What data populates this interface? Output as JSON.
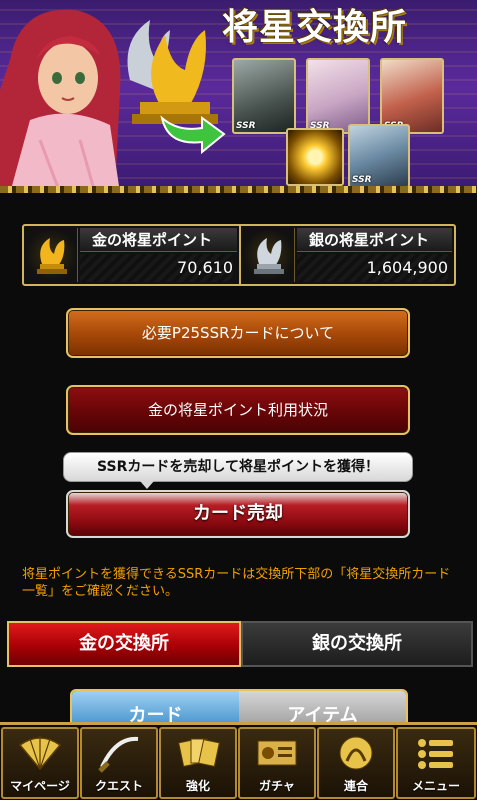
{
  "banner": {
    "title": "将星交換所",
    "card_badges": [
      "SSR",
      "SSR",
      "SSR",
      "SSR"
    ]
  },
  "points": {
    "gold": {
      "label": "金の将星ポイント",
      "value": "70,610",
      "icon": "gold-phoenix-statue-icon"
    },
    "silver": {
      "label": "銀の将星ポイント",
      "value": "1,604,900",
      "icon": "silver-phoenix-statue-icon"
    }
  },
  "buttons": {
    "p25_label": "必要P25SSRカードについて",
    "usage_label": "金の将星ポイント利用状況",
    "sell_tip": "SSRカードを売却して将星ポイントを獲得！",
    "sell_label": "カード売却"
  },
  "notice": "将星ポイントを獲得できるSSRカードは交換所下部の「将星交換所カード一覧」をご確認ください。",
  "exchange_tabs": {
    "gold": "金の交換所",
    "silver": "銀の交換所"
  },
  "sub_tabs": {
    "card": "カード",
    "item": "アイテム"
  },
  "nav": {
    "items": [
      {
        "label": "マイページ",
        "icon": "fan-icon"
      },
      {
        "label": "クエスト",
        "icon": "sword-icon"
      },
      {
        "label": "強化",
        "icon": "cards-icon"
      },
      {
        "label": "ガチャ",
        "icon": "gacha-scroll-icon"
      },
      {
        "label": "連合",
        "icon": "alliance-icon"
      },
      {
        "label": "メニュー",
        "icon": "menu-list-icon"
      }
    ]
  },
  "colors": {
    "gold_border": "#e8c162",
    "notice_text": "#f2a000",
    "active_tab": "#c3000a"
  }
}
